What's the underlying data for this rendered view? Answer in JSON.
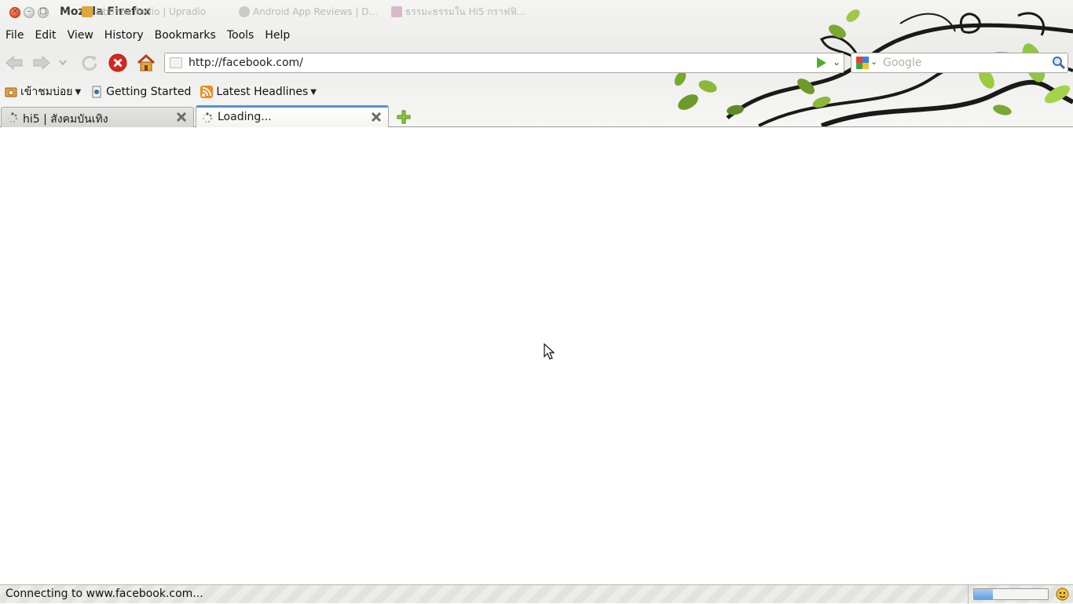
{
  "window": {
    "title": "Mozilla Firefox",
    "ghost_tabs": [
      "Ubuntu Radio | Upradio",
      "Android App Reviews | D...",
      "ธรรมะธรรมใน Hi5 กราฟฟิ..."
    ]
  },
  "menu": {
    "items": [
      {
        "label": "File",
        "accel": "F"
      },
      {
        "label": "Edit",
        "accel": "E"
      },
      {
        "label": "View",
        "accel": "V"
      },
      {
        "label": "History",
        "accel": "s"
      },
      {
        "label": "Bookmarks",
        "accel": "B"
      },
      {
        "label": "Tools",
        "accel": "T"
      },
      {
        "label": "Help",
        "accel": "H"
      }
    ]
  },
  "navbar": {
    "url": "http://facebook.com/",
    "search_placeholder": "Google"
  },
  "bookmarks": {
    "most_visited": "เข้าชมบ่อย",
    "getting_started": "Getting Started",
    "latest_headlines": "Latest Headlines"
  },
  "tabs": [
    {
      "label": "hi5 | สังคมบันเทิง",
      "selected": false
    },
    {
      "label": "Loading...",
      "selected": true
    }
  ],
  "status": {
    "text": "Connecting to www.facebook.com...",
    "progress_fraction": 0.25
  },
  "colors": {
    "stop_red": "#d7261e",
    "go_green": "#4caf27",
    "tab_selected_accent": "#5a8fd6"
  },
  "icons": {
    "back": "back-arrow-icon",
    "forward": "forward-arrow-icon",
    "reload": "reload-icon",
    "stop": "stop-icon",
    "home": "home-icon"
  }
}
